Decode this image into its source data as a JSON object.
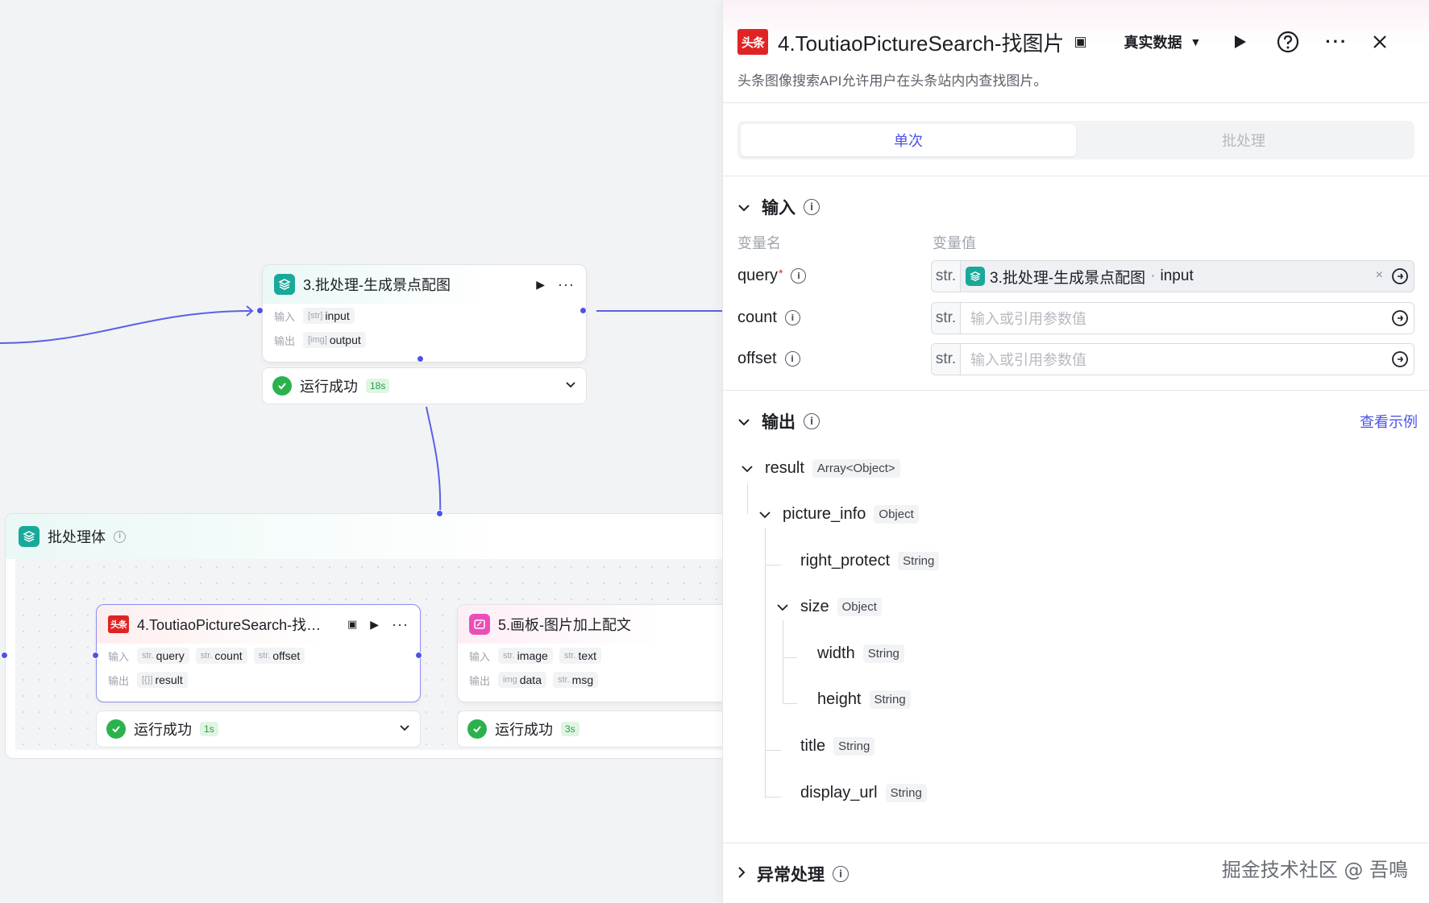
{
  "canvas": {
    "node3": {
      "title": "3.批处理-生成景点配图",
      "input_label": "输入",
      "output_label": "输出",
      "input_chip": {
        "type": "[str]",
        "name": "input"
      },
      "output_chip": {
        "type": "[img]",
        "name": "output"
      },
      "status": "运行成功",
      "time": "18s"
    },
    "batch_body": {
      "title": "批处理体"
    },
    "node4": {
      "title": "4.ToutiaoPictureSearch-找…",
      "icon_text": "头条",
      "input_label": "输入",
      "output_label": "输出",
      "inputs": [
        {
          "type": "str.",
          "name": "query"
        },
        {
          "type": "str.",
          "name": "count"
        },
        {
          "type": "str.",
          "name": "offset"
        }
      ],
      "outputs": [
        {
          "type": "[{}]",
          "name": "result"
        }
      ],
      "status": "运行成功",
      "time": "1s"
    },
    "node5": {
      "title": "5.画板-图片加上配文",
      "input_label": "输入",
      "output_label": "输出",
      "inputs": [
        {
          "type": "str.",
          "name": "image"
        },
        {
          "type": "str.",
          "name": "text"
        }
      ],
      "outputs": [
        {
          "type": "img",
          "name": "data"
        },
        {
          "type": "str.",
          "name": "msg"
        }
      ],
      "status": "运行成功",
      "time": "3s"
    }
  },
  "panel": {
    "icon_text": "头条",
    "title": "4.ToutiaoPictureSearch-找图片",
    "data_mode": "真实数据",
    "description": "头条图像搜索API允许用户在头条站内内查找图片。",
    "tabs": [
      "单次",
      "批处理"
    ],
    "input_section": {
      "title": "输入",
      "col_name": "变量名",
      "col_value": "变量值",
      "params": [
        {
          "name": "query",
          "required": "*",
          "type": "str.",
          "ref_node": "3.批处理-生成景点配图",
          "ref_sep": "·",
          "ref_var": "input",
          "clear": "×"
        },
        {
          "name": "count",
          "type": "str.",
          "placeholder": "输入或引用参数值"
        },
        {
          "name": "offset",
          "type": "str.",
          "placeholder": "输入或引用参数值"
        }
      ]
    },
    "output_section": {
      "title": "输出",
      "view_example": "查看示例",
      "tree": [
        {
          "name": "result",
          "type": "Array<Object>"
        },
        {
          "name": "picture_info",
          "type": "Object"
        },
        {
          "name": "right_protect",
          "type": "String"
        },
        {
          "name": "size",
          "type": "Object"
        },
        {
          "name": "width",
          "type": "String"
        },
        {
          "name": "height",
          "type": "String"
        },
        {
          "name": "title",
          "type": "String"
        },
        {
          "name": "display_url",
          "type": "String"
        }
      ]
    },
    "exception_section": {
      "title": "异常处理"
    }
  },
  "watermark": "掘金技术社区 @ 吾鳴",
  "colors": {
    "accent": "#4d53e8",
    "success": "#2bb24c",
    "teal_icon": "#19a99a",
    "red_icon": "#e02424",
    "pink_icon": "#e94fb7"
  }
}
